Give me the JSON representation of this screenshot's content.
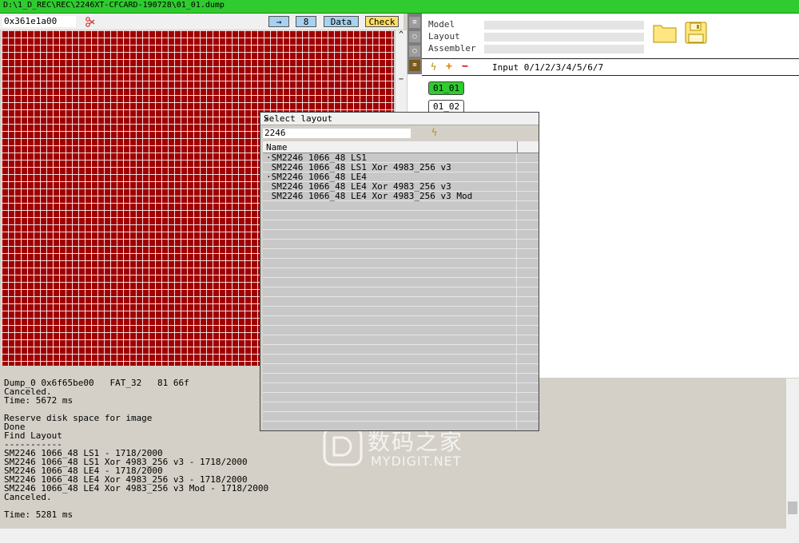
{
  "window": {
    "title": "D:\\1_D_REC\\REC\\2246XT-CFCARD-190728\\01_01.dump"
  },
  "hex_toolbar": {
    "address": "0x361e1a00",
    "goto_label": "→",
    "width_value": "8",
    "data_label": "Data",
    "check_label": "Check"
  },
  "vscroll": {
    "up": "^",
    "minus": "−"
  },
  "right_panel": {
    "model_label": "Model",
    "layout_label": "Layout",
    "assembler_label": "Assembler",
    "input_label": "Input 0/1/2/3/4/5/6/7",
    "layers": [
      "01_01",
      "01_02"
    ]
  },
  "log_lines": [
    "Dump_0 0x6f65be00   FAT_32   81 66f",
    "Canceled.",
    "Time: 5672 ms",
    "",
    "Reserve disk space for image",
    "Done",
    "Find Layout",
    "-----------",
    "SM2246 1066_48 LS1 - 1718/2000",
    "SM2246 1066_48 LS1 Xor 4983_256 v3 - 1718/2000",
    "SM2246 1066_48 LE4 - 1718/2000",
    "SM2246 1066_48 LE4 Xor 4983_256 v3 - 1718/2000",
    "SM2246 1066_48 LE4 Xor 4983_256 v3 Mod - 1718/2000",
    "Canceled.",
    "",
    "Time: 5281 ms"
  ],
  "dialog": {
    "title": "Select layout",
    "close": "✕",
    "search_value": "2246",
    "column_name": "Name",
    "rows": [
      "·SM2246 1066_48 LS1",
      " SM2246 1066_48 LS1 Xor 4983_256 v3",
      "·SM2246 1066_48 LE4",
      " SM2246 1066_48 LE4 Xor 4983_256 v3",
      " SM2246 1066_48 LE4 Xor 4983_256 v3 Mod"
    ]
  },
  "watermark": {
    "cn": "数码之家",
    "en": "MYDIGIT.NET"
  },
  "colors": {
    "titlebar": "#2fcb2f",
    "sector_grid": "#a00000",
    "active_layer": "#2fcb2f",
    "check_button": "#ffe066",
    "buttons": "#a6d1ef"
  }
}
